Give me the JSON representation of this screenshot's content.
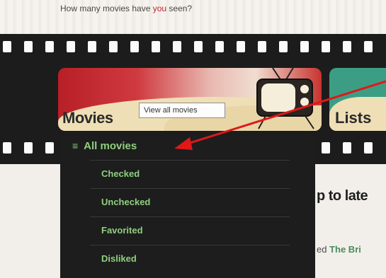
{
  "header": {
    "tagline_prefix": "How many movies have ",
    "tagline_highlight": "you",
    "tagline_suffix": " seen?"
  },
  "nav": {
    "movies_label": "Movies",
    "lists_label": "Lists",
    "tooltip": "View all movies"
  },
  "dropdown": {
    "header_icon": "menu-icon",
    "header": "All movies",
    "items": [
      "Checked",
      "Unchecked",
      "Favorited",
      "Disliked"
    ]
  },
  "content": {
    "headline": "p to late",
    "activity_prefix": "ed ",
    "activity_link": "The Bri"
  },
  "colors": {
    "accent_green": "#8fcf7e",
    "movies_red": "#b81f27",
    "annotation_arrow": "#e01818"
  }
}
